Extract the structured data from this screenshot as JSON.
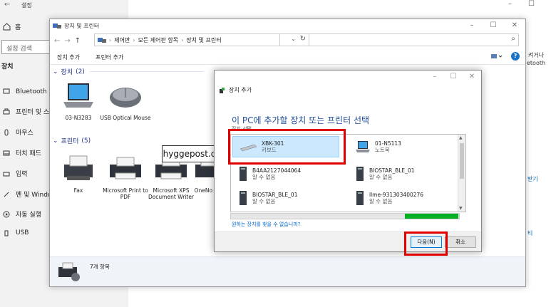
{
  "settings": {
    "title": "설정",
    "back_glyph": "←",
    "home_label": "홈",
    "search_placeholder": "설정 검색",
    "section": "장치",
    "nav": [
      {
        "label": "Bluetooth 및",
        "icon": "bluetooth-icon"
      },
      {
        "label": "프린터 및 스",
        "icon": "printer-icon"
      },
      {
        "label": "마우스",
        "icon": "mouse-icon"
      },
      {
        "label": "터치 패드",
        "icon": "touchpad-icon"
      },
      {
        "label": "입력",
        "icon": "keyboard-icon"
      },
      {
        "label": "펜 및 Window",
        "icon": "pen-icon"
      },
      {
        "label": "자동 실행",
        "icon": "autoplay-icon"
      },
      {
        "label": "USB",
        "icon": "usb-icon"
      }
    ],
    "frag_right_1": "켜거나",
    "frag_right_2": "etooth",
    "frag_right_3": "받기",
    "frag_right_4": "티"
  },
  "control_panel": {
    "title": "장치 및 프린터",
    "breadcrumb": [
      "제어판",
      "모든 제어판 항목",
      "장치 및 프린터"
    ],
    "toolbar": [
      "장치 추가",
      "프린터 추가"
    ],
    "help_glyph": "?",
    "devices_group": {
      "label": "장치",
      "count": "(2)"
    },
    "devices": [
      {
        "name": "03-N3283",
        "icon": "laptop-icon"
      },
      {
        "name": "USB Optical Mouse",
        "icon": "mouse-device-icon"
      }
    ],
    "printers_group": {
      "label": "프린터",
      "count": "(5)"
    },
    "printers": [
      {
        "name": "Fax",
        "icon": "fax-icon"
      },
      {
        "name": "Microsoft Print to PDF",
        "icon": "printer-device-icon"
      },
      {
        "name": "Microsoft XPS Document Writer",
        "icon": "printer-device-icon"
      },
      {
        "name": "OneNo 로",
        "icon": "printer-device-icon"
      }
    ],
    "status_count": "7개 항목"
  },
  "watermark": "hyggepost.com",
  "dialog": {
    "header": "장치 추가",
    "title": "이 PC에 추가할 장치 또는 프린터 선택",
    "subtitle": "장치 선택",
    "items": [
      {
        "name": "XBK-301",
        "type": "키보드",
        "icon": "keyboard-device-icon",
        "selected": true
      },
      {
        "name": "01-N5113",
        "type": "노트북",
        "icon": "laptop-icon",
        "selected": false
      },
      {
        "name": "B4AA2127044064",
        "type": "알 수 없음",
        "icon": "unknown-device-icon",
        "selected": false
      },
      {
        "name": "BIOSTAR_BLE_01",
        "type": "알 수 없음",
        "icon": "unknown-device-icon",
        "selected": false
      },
      {
        "name": "BIOSTAR_BLE_01",
        "type": "알 수 없음",
        "icon": "unknown-device-icon",
        "selected": false
      },
      {
        "name": "llme-931303400276",
        "type": "알 수 없음",
        "icon": "unknown-device-icon",
        "selected": false
      }
    ],
    "progress": 0.23,
    "link": "원하는 장치를 찾을 수 없습니까?",
    "next_label": "다음(N)",
    "cancel_label": "취소"
  },
  "colors": {
    "accent_blue": "#1f4e9b",
    "selection": "#cce8ff",
    "progress_green": "#06b025",
    "annotation_red": "#e00000"
  }
}
